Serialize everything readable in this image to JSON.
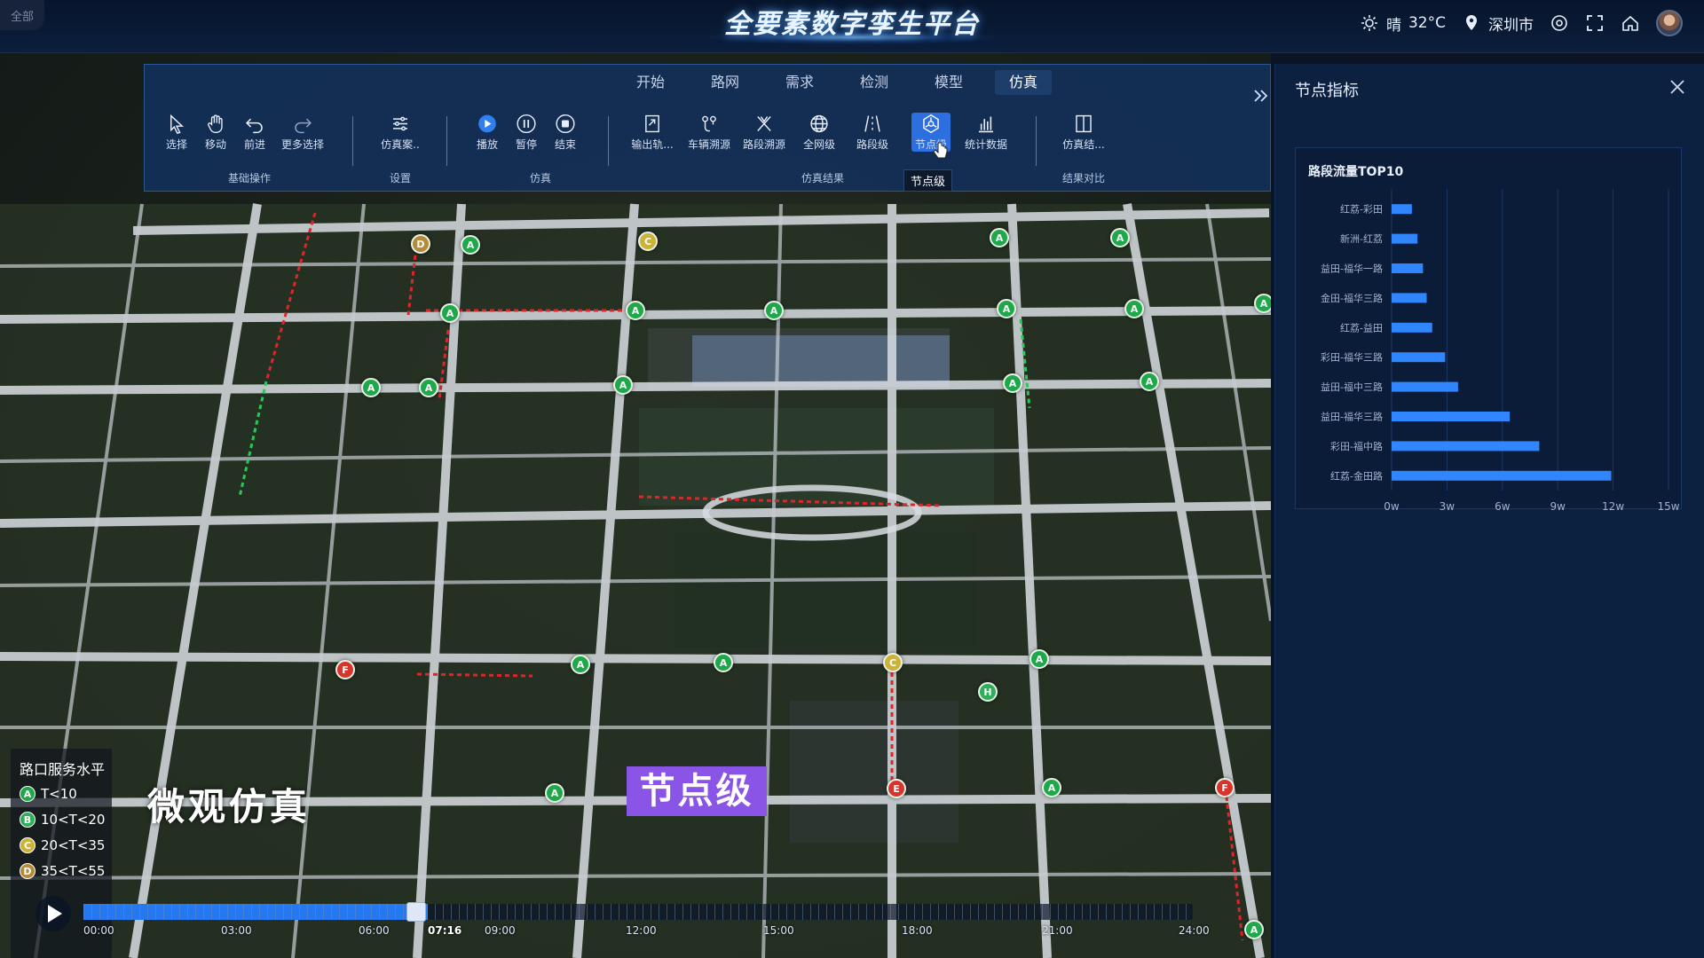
{
  "header": {
    "corner_label": "全部",
    "title": "全要素数字孪生平台",
    "weather": "晴",
    "temperature": "32°C",
    "city": "深圳市",
    "icons": [
      "sun-icon",
      "location-pin-icon",
      "target-icon",
      "fullscreen-icon",
      "home-icon",
      "avatar"
    ]
  },
  "toolbar": {
    "tabs": [
      "开始",
      "路网",
      "需求",
      "检测",
      "模型",
      "仿真"
    ],
    "active_tab": "仿真",
    "groups": {
      "basic": {
        "label": "基础操作",
        "tools": [
          "选择",
          "移动",
          "前进",
          "更多选择"
        ]
      },
      "settings": {
        "label": "设置",
        "tools": [
          "仿真案.."
        ]
      },
      "simulation": {
        "label": "仿真",
        "tools": [
          "播放",
          "暂停",
          "结束"
        ]
      },
      "results": {
        "label": "仿真结果",
        "tools": [
          "输出轨...",
          "车辆溯源",
          "路段溯源",
          "全网级",
          "路段级",
          "节点级",
          "统计数据"
        ]
      },
      "compare": {
        "label": "结果对比",
        "tools": [
          "仿真结..."
        ]
      }
    },
    "selected_tool": "节点级",
    "tooltip": "节点级"
  },
  "panel": {
    "title": "节点指标",
    "card_title": "路段流量TOP10"
  },
  "chart_data": {
    "type": "bar",
    "orientation": "horizontal",
    "title": "路段流量TOP10",
    "categories": [
      "红荔-彩田",
      "新洲-红荔",
      "益田-福华一路",
      "金田-福华三路",
      "红荔-益田",
      "彩田-福华三路",
      "益田-福中三路",
      "益田-福华三路",
      "彩田-福中路",
      "红荔-金田路"
    ],
    "values": [
      1.1,
      1.4,
      1.7,
      1.9,
      2.2,
      2.9,
      3.6,
      6.4,
      8.0,
      11.9
    ],
    "x_ticks": [
      "0w",
      "3w",
      "6w",
      "9w",
      "12w",
      "15w"
    ],
    "xlim": [
      0,
      15
    ],
    "unit": "w",
    "bar_color": "#2f86ff",
    "grid": true
  },
  "legend": {
    "title": "路口服务水平",
    "items": [
      {
        "grade": "A",
        "label": "T<10",
        "color": "#1fa84a"
      },
      {
        "grade": "B",
        "label": "10<T<20",
        "color": "#2fae5a"
      },
      {
        "grade": "C",
        "label": "20<T<35",
        "color": "#cdb23a"
      },
      {
        "grade": "D",
        "label": "35<T<55",
        "color": "#b58b3a"
      }
    ]
  },
  "captions": {
    "micro": "微观仿真",
    "node": "节点级"
  },
  "timeline": {
    "labels": [
      "00:00",
      "03:00",
      "06:00",
      "07:16",
      "09:00",
      "12:00",
      "15:00",
      "18:00",
      "21:00",
      "24:00"
    ],
    "current": "07:16",
    "progress": 0.31,
    "playhead": 0.3
  },
  "map_markers": [
    {
      "grade": "A"
    },
    {
      "grade": "A"
    },
    {
      "grade": "A"
    },
    {
      "grade": "A"
    },
    {
      "grade": "A"
    },
    {
      "grade": "A"
    },
    {
      "grade": "A"
    },
    {
      "grade": "A"
    },
    {
      "grade": "A"
    },
    {
      "grade": "A"
    },
    {
      "grade": "A"
    },
    {
      "grade": "A"
    },
    {
      "grade": "A"
    },
    {
      "grade": "A"
    },
    {
      "grade": "A"
    },
    {
      "grade": "A"
    },
    {
      "grade": "A"
    },
    {
      "grade": "A"
    },
    {
      "grade": "A"
    },
    {
      "grade": "A"
    },
    {
      "grade": "C"
    },
    {
      "grade": "C"
    },
    {
      "grade": "D"
    },
    {
      "grade": "E"
    },
    {
      "grade": "F"
    },
    {
      "grade": "F"
    },
    {
      "grade": "H"
    }
  ]
}
